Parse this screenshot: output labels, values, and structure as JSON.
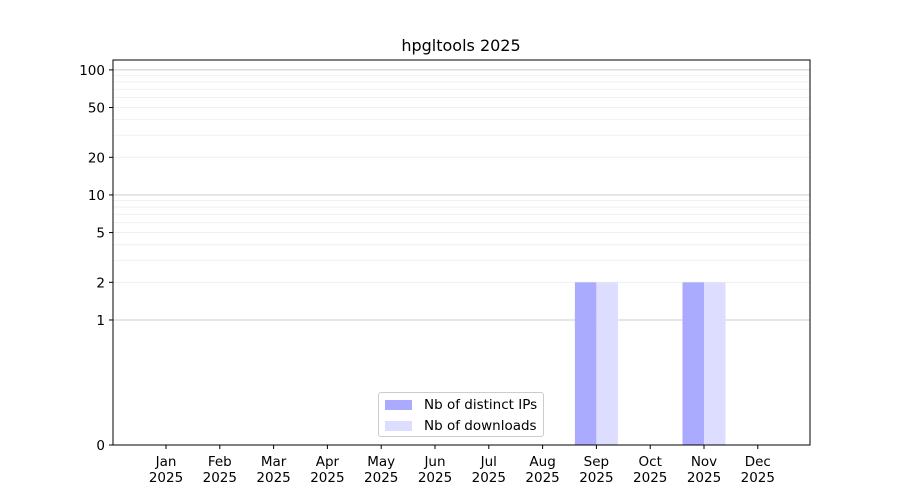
{
  "chart_data": {
    "type": "bar",
    "title": "hpgltools 2025",
    "xlabel": "",
    "ylabel": "",
    "y_scale": "symlog",
    "ylim": [
      0,
      120
    ],
    "y_ticks": [
      0,
      1,
      2,
      5,
      10,
      20,
      50,
      100
    ],
    "grid": true,
    "legend_position": "lower-center",
    "categories": [
      "Jan\n2025",
      "Feb\n2025",
      "Mar\n2025",
      "Apr\n2025",
      "May\n2025",
      "Jun\n2025",
      "Jul\n2025",
      "Aug\n2025",
      "Sep\n2025",
      "Oct\n2025",
      "Nov\n2025",
      "Dec\n2025"
    ],
    "series": [
      {
        "name": "Nb of distinct IPs",
        "color": "#aaaaff",
        "values": [
          0,
          0,
          0,
          0,
          0,
          0,
          0,
          0,
          2,
          0,
          2,
          0
        ]
      },
      {
        "name": "Nb of downloads",
        "color": "#ddddff",
        "values": [
          0,
          0,
          0,
          0,
          0,
          0,
          0,
          0,
          2,
          0,
          2,
          0
        ]
      }
    ]
  }
}
